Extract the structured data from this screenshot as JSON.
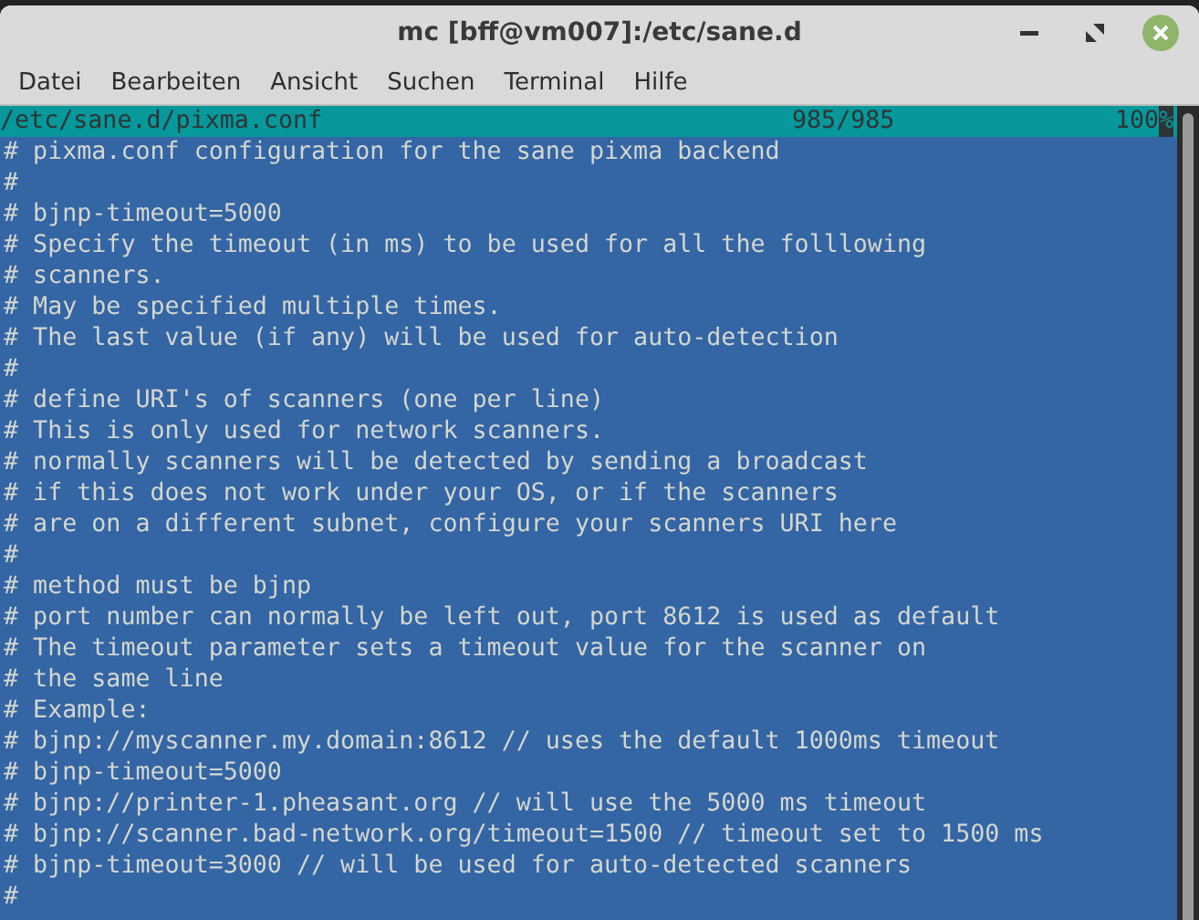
{
  "window": {
    "title": "mc [bff@vm007]:/etc/sane.d"
  },
  "menu": [
    "Datei",
    "Bearbeiten",
    "Ansicht",
    "Suchen",
    "Terminal",
    "Hilfe"
  ],
  "status_bar": {
    "file": "/etc/sane.d/pixma.conf",
    "position": "985/985",
    "percent": "100",
    "cursor_char": "%"
  },
  "lines": [
    "# pixma.conf configuration for the sane pixma backend",
    "#",
    "# bjnp-timeout=5000",
    "# Specify the timeout (in ms) to be used for all the folllowing",
    "# scanners.",
    "# May be specified multiple times.",
    "# The last value (if any) will be used for auto-detection",
    "#",
    "# define URI's of scanners (one per line)",
    "# This is only used for network scanners.",
    "# normally scanners will be detected by sending a broadcast",
    "# if this does not work under your OS, or if the scanners",
    "# are on a different subnet, configure your scanners URI here",
    "#",
    "# method must be bjnp",
    "# port number can normally be left out, port 8612 is used as default",
    "# The timeout parameter sets a timeout value for the scanner on",
    "# the same line",
    "# Example:",
    "# bjnp://myscanner.my.domain:8612 // uses the default 1000ms timeout",
    "# bjnp-timeout=5000",
    "# bjnp://printer-1.pheasant.org // will use the 5000 ms timeout",
    "# bjnp://scanner.bad-network.org/timeout=1500 // timeout set to 1500 ms",
    "# bjnp-timeout=3000 // will be used for auto-detected scanners",
    "#"
  ]
}
